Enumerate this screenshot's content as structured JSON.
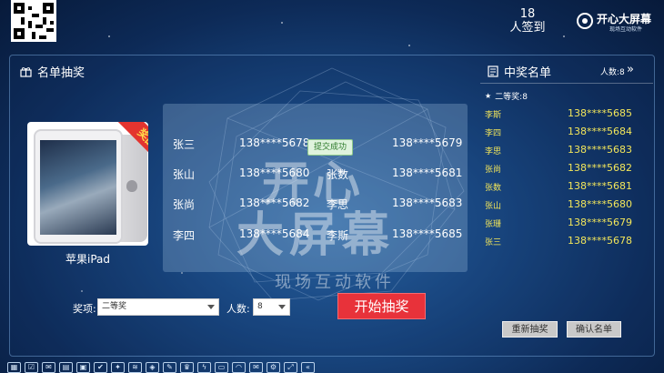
{
  "header": {
    "checkin_count": "18",
    "checkin_label": "人签到",
    "brand_name": "开心大屏幕",
    "brand_sub": "现场互动软件"
  },
  "lottery": {
    "title": "名单抽奖",
    "prize_badge": "奖品",
    "prize_name": "苹果iPad",
    "candidates": [
      {
        "name": "张三",
        "phone": "138****5678"
      },
      {
        "name": "",
        "phone": "138****5679"
      },
      {
        "name": "张山",
        "phone": "138****5680"
      },
      {
        "name": "张数",
        "phone": "138****5681"
      },
      {
        "name": "张尚",
        "phone": "138****5682"
      },
      {
        "name": "李思",
        "phone": "138****5683"
      },
      {
        "name": "李四",
        "phone": "138****5684"
      },
      {
        "name": "李斯",
        "phone": "138****5685"
      }
    ],
    "toast": "提交成功",
    "prize_label": "奖项:",
    "prize_select": "二等奖",
    "count_label": "人数:",
    "count_select": "8",
    "start_button": "开始抽奖"
  },
  "watermark": {
    "line1": "开心",
    "line2": "大屏幕",
    "line3": "现场互动软件"
  },
  "winners": {
    "title": "中奖名单",
    "count": "人数:8",
    "more_icon": "»",
    "prize_group": "二等奖:8",
    "list": [
      {
        "name": "李斯",
        "phone": "138****5685"
      },
      {
        "name": "李四",
        "phone": "138****5684"
      },
      {
        "name": "李思",
        "phone": "138****5683"
      },
      {
        "name": "张尚",
        "phone": "138****5682"
      },
      {
        "name": "张数",
        "phone": "138****5681"
      },
      {
        "name": "张山",
        "phone": "138****5680"
      },
      {
        "name": "张珊",
        "phone": "138****5679"
      },
      {
        "name": "张三",
        "phone": "138****5678"
      }
    ],
    "redraw_button": "重新抽奖",
    "confirm_button": "确认名单"
  },
  "toolbar": {
    "icons": [
      "qr-icon",
      "checkin-icon",
      "message-icon",
      "wall-icon",
      "photo-icon",
      "vote-icon",
      "lottery-icon",
      "shake-icon",
      "game-icon",
      "draw-icon",
      "award-icon",
      "flash-icon",
      "doc-icon",
      "wifi-icon",
      "mail-icon",
      "settings-icon",
      "fullscreen-icon",
      "back-icon"
    ]
  }
}
